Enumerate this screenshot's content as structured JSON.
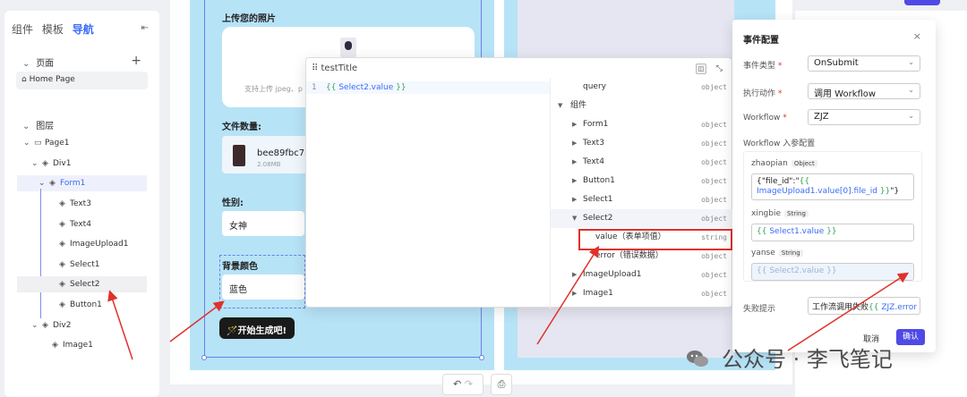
{
  "sidebar": {
    "tabs": [
      "组件",
      "模板",
      "导航"
    ],
    "active_tab": "导航",
    "pages_header": "页面",
    "home_page": "Home Page",
    "layers_header": "图层",
    "tree": [
      "Page1",
      "Div1",
      "Form1",
      "Text3",
      "Text4",
      "ImageUpload1",
      "Select1",
      "Select2",
      "Button1",
      "Div2",
      "Image1"
    ]
  },
  "canvas": {
    "upload_label": "上传您的照片",
    "upload_hint": "支持上传 jpeg、p",
    "file_count_label": "文件数量:",
    "file_name": "bee89fbc72",
    "file_size": "2.08MB",
    "gender_label": "性别:",
    "gender_value": "女神",
    "bg_color_label": "背景颜色",
    "bg_color_value": "蓝色",
    "generate_button": "🪄开始生成吧!"
  },
  "popup": {
    "title": "testTitle",
    "line_number": "1",
    "code_open": "{{ ",
    "code_var": "Select2.value",
    "code_close": " }}",
    "tree": [
      {
        "name": "query",
        "type": "object"
      },
      {
        "name": "组件",
        "type": ""
      },
      {
        "name": "Form1",
        "type": "object"
      },
      {
        "name": "Text3",
        "type": "object"
      },
      {
        "name": "Text4",
        "type": "object"
      },
      {
        "name": "Button1",
        "type": "object"
      },
      {
        "name": "Select1",
        "type": "object"
      },
      {
        "name": "Select2",
        "type": "object"
      },
      {
        "name": "value（表单项值）",
        "type": "string"
      },
      {
        "name": "error（错误数据）",
        "type": "object"
      },
      {
        "name": "ImageUpload1",
        "type": "object"
      },
      {
        "name": "Image1",
        "type": "object"
      }
    ]
  },
  "event_config": {
    "title": "事件配置",
    "event_type_label": "事件类型",
    "event_type_value": "OnSubmit",
    "action_label": "执行动作",
    "action_value": "调用 Workflow",
    "workflow_label": "Workflow",
    "workflow_value": "ZJZ",
    "params_header": "Workflow 入参配置",
    "params": [
      {
        "name": "zhaopian",
        "type": "Object",
        "prefix": "{\"file_id\":\"",
        "open": "{{ ",
        "var": "ImageUpload1.value[0].file_id",
        "close": " }}",
        "suffix": "\"}"
      },
      {
        "name": "xingbie",
        "type": "String",
        "open": "{{ ",
        "var": "Select1.value",
        "close": " }}"
      },
      {
        "name": "yanse",
        "type": "String",
        "open": "{{ ",
        "var": "Select2.value",
        "close": " }}"
      }
    ],
    "fail_label": "失败提示",
    "fail_text": "工作流调用失败",
    "fail_open": "{{ ",
    "fail_var": "ZJZ.error",
    "fail_close": " }}",
    "cancel": "取消",
    "ok": "确认"
  },
  "watermark": "公众号 · 李飞笔记",
  "colors": {
    "accent": "#4f49e6",
    "highlight_red": "#e0312a",
    "form_bg": "#b7e3f7"
  }
}
